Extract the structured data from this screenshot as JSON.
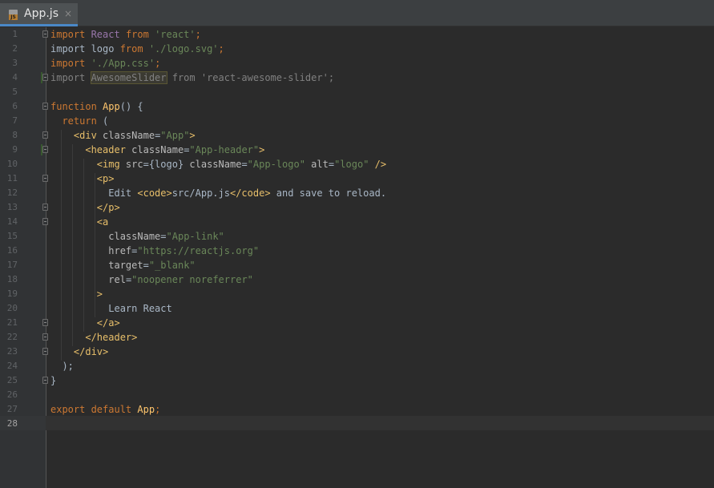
{
  "tab": {
    "label": "App.js",
    "close_glyph": "×",
    "icon": "js-file-icon"
  },
  "editor": {
    "current_line": 28,
    "lines": [
      {
        "n": "1",
        "tokens": [
          [
            "kw",
            "import "
          ],
          [
            "cls",
            "React "
          ],
          [
            "kw",
            "from "
          ],
          [
            "str",
            "'react'"
          ],
          [
            "kw",
            ";"
          ]
        ]
      },
      {
        "n": "2",
        "tokens": [
          [
            "txt",
            "import logo "
          ],
          [
            "kw",
            "from "
          ],
          [
            "str",
            "'./logo.svg'"
          ],
          [
            "kw",
            ";"
          ]
        ]
      },
      {
        "n": "3",
        "tokens": [
          [
            "kw",
            "import "
          ],
          [
            "str",
            "'./App.css'"
          ],
          [
            "kw",
            ";"
          ]
        ]
      },
      {
        "n": "4",
        "tokens": [
          [
            "unused",
            "import "
          ],
          [
            "unused-hl",
            "AwesomeSlider"
          ],
          [
            "unused",
            " from "
          ],
          [
            "unused",
            "'react-awesome-slider'"
          ],
          [
            "unused",
            ";"
          ]
        ]
      },
      {
        "n": "5",
        "tokens": []
      },
      {
        "n": "6",
        "tokens": [
          [
            "kw",
            "function "
          ],
          [
            "fn",
            "App"
          ],
          [
            "txt",
            "() {"
          ]
        ]
      },
      {
        "n": "7",
        "tokens": [
          [
            "txt",
            "  "
          ],
          [
            "kw",
            "return "
          ],
          [
            "txt",
            "("
          ]
        ]
      },
      {
        "n": "8",
        "tokens": [
          [
            "txt",
            "    "
          ],
          [
            "tag",
            "<div "
          ],
          [
            "attr",
            "className"
          ],
          [
            "txt",
            "="
          ],
          [
            "str",
            "\"App\""
          ],
          [
            "tag",
            ">"
          ]
        ]
      },
      {
        "n": "9",
        "tokens": [
          [
            "txt",
            "      "
          ],
          [
            "tag",
            "<header "
          ],
          [
            "attr",
            "className"
          ],
          [
            "txt",
            "="
          ],
          [
            "str",
            "\"App-header\""
          ],
          [
            "tag",
            ">"
          ]
        ]
      },
      {
        "n": "10",
        "tokens": [
          [
            "txt",
            "        "
          ],
          [
            "tag",
            "<img "
          ],
          [
            "attr",
            "src"
          ],
          [
            "txt",
            "={logo} "
          ],
          [
            "attr",
            "className"
          ],
          [
            "txt",
            "="
          ],
          [
            "str",
            "\"App-logo\" "
          ],
          [
            "attr",
            "alt"
          ],
          [
            "txt",
            "="
          ],
          [
            "str",
            "\"logo\" "
          ],
          [
            "tag",
            "/>"
          ]
        ]
      },
      {
        "n": "11",
        "tokens": [
          [
            "txt",
            "        "
          ],
          [
            "tag",
            "<p>"
          ]
        ]
      },
      {
        "n": "12",
        "tokens": [
          [
            "txt",
            "          Edit "
          ],
          [
            "tag",
            "<code>"
          ],
          [
            "txt",
            "src/App.js"
          ],
          [
            "tag",
            "</code>"
          ],
          [
            "txt",
            " and save to reload."
          ]
        ]
      },
      {
        "n": "13",
        "tokens": [
          [
            "txt",
            "        "
          ],
          [
            "tag",
            "</p>"
          ]
        ]
      },
      {
        "n": "14",
        "tokens": [
          [
            "txt",
            "        "
          ],
          [
            "tag",
            "<a"
          ]
        ]
      },
      {
        "n": "15",
        "tokens": [
          [
            "txt",
            "          "
          ],
          [
            "attr",
            "className"
          ],
          [
            "txt",
            "="
          ],
          [
            "str",
            "\"App-link\""
          ]
        ]
      },
      {
        "n": "16",
        "tokens": [
          [
            "txt",
            "          "
          ],
          [
            "attr",
            "href"
          ],
          [
            "txt",
            "="
          ],
          [
            "str",
            "\"https://reactjs.org\""
          ]
        ]
      },
      {
        "n": "17",
        "tokens": [
          [
            "txt",
            "          "
          ],
          [
            "attr",
            "target"
          ],
          [
            "txt",
            "="
          ],
          [
            "str",
            "\"_blank\""
          ]
        ]
      },
      {
        "n": "18",
        "tokens": [
          [
            "txt",
            "          "
          ],
          [
            "attr",
            "rel"
          ],
          [
            "txt",
            "="
          ],
          [
            "str",
            "\"noopener noreferrer\""
          ]
        ]
      },
      {
        "n": "19",
        "tokens": [
          [
            "txt",
            "        "
          ],
          [
            "tag",
            ">"
          ]
        ]
      },
      {
        "n": "20",
        "tokens": [
          [
            "txt",
            "          Learn React"
          ]
        ]
      },
      {
        "n": "21",
        "tokens": [
          [
            "txt",
            "        "
          ],
          [
            "tag",
            "</a>"
          ]
        ]
      },
      {
        "n": "22",
        "tokens": [
          [
            "txt",
            "      "
          ],
          [
            "tag",
            "</header>"
          ]
        ]
      },
      {
        "n": "23",
        "tokens": [
          [
            "txt",
            "    "
          ],
          [
            "tag",
            "</div>"
          ]
        ]
      },
      {
        "n": "24",
        "tokens": [
          [
            "txt",
            "  );"
          ]
        ]
      },
      {
        "n": "25",
        "tokens": [
          [
            "txt",
            "}"
          ]
        ]
      },
      {
        "n": "26",
        "tokens": []
      },
      {
        "n": "27",
        "tokens": [
          [
            "kw",
            "export default "
          ],
          [
            "fn",
            "App"
          ],
          [
            "kw",
            ";"
          ]
        ]
      },
      {
        "n": "28",
        "tokens": []
      }
    ]
  }
}
